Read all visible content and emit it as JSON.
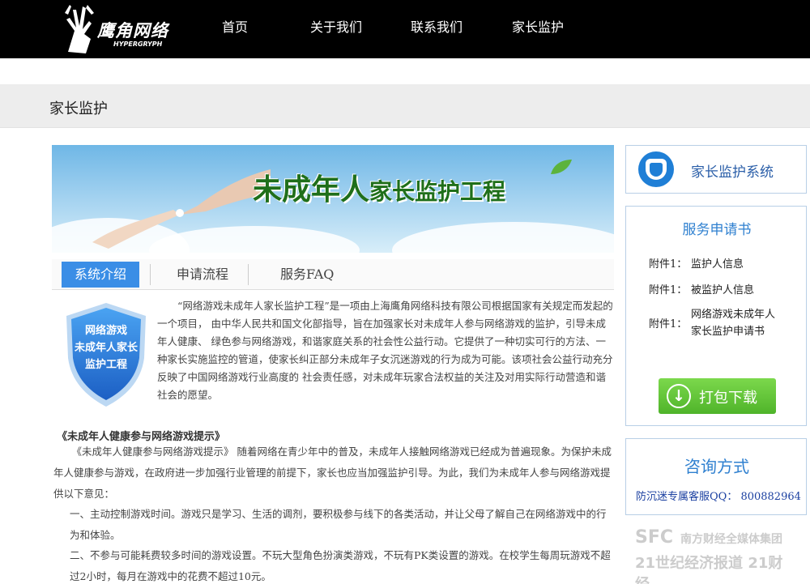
{
  "brand": {
    "name": "鹰角网络",
    "sub": "HYPERGRYPH"
  },
  "nav": [
    "首页",
    "关于我们",
    "联系我们",
    "家长监护"
  ],
  "page_title": "家长监护",
  "banner": {
    "title_big": "未成年人",
    "title_small": "家长监护工程"
  },
  "tabs": [
    "系统介绍",
    "申请流程",
    "服务FAQ"
  ],
  "badge": {
    "line1": "网络游戏",
    "line2": "未成年人家长",
    "line3": "监护工程"
  },
  "intro": "“网络游戏未成年人家长监护工程”是一项由上海鹰角网络科技有限公司根据国家有关规定而发起的一个项目， 由中华人民共和国文化部指导，旨在加强家长对未成年人参与网络游戏的监护，引导未成年人健康、 绿色参与网络游戏，和谐家庭关系的社会性公益行动。它提供了一种切实可行的方法、一种家长实施监控的管道，使家长纠正部分未成年子女沉迷游戏的行为成为可能。该项社会公益行动充分反映了中国网络游戏行业高度的 社会责任感，对未成年玩家合法权益的关注及对用实际行动营造和谐社会的愿望。",
  "section_title": "《未成年人健康参与网络游戏提示》",
  "para1": "《未成年人健康参与网络游戏提示》 随着网络在青少年中的普及，未成年人接触网络游戏已经成为普遍现象。为保护未成年人健康参与游戏，在政府进一步加强行业管理的前提下，家长也应当加强监护引导。为此，我们为未成年人参与网络游戏提供以下意见：",
  "para2": "一、主动控制游戏时间。游戏只是学习、生活的调剂，要积极参与线下的各类活动，并让父母了解自己在网络游戏中的行为和体验。",
  "para3": "二、不参与可能耗费较多时间的游戏设置。不玩大型角色扮演类游戏，不玩有PK类设置的游戏。在校学生每周玩游戏不超过2小时，每月在游戏中的花费不超过10元。",
  "sidebar": {
    "system_label": "家长监护系统",
    "application_title": "服务申请书",
    "attachments": [
      {
        "key": "附件1：",
        "value": "监护人信息"
      },
      {
        "key": "附件1：",
        "value": "被监护人信息"
      },
      {
        "key": "附件1：",
        "value_line1": "网络游戏未成年人",
        "value_line2": "家长监护申请书"
      }
    ],
    "download_label": "打包下载",
    "contact_title": "咨询方式",
    "contact_line": "防沉迷专属客服QQ： 800882964"
  },
  "watermark": {
    "line1": "SFC",
    "line1b": "南方财经全媒体集团",
    "line2": "21世纪经济报道 21财经"
  }
}
